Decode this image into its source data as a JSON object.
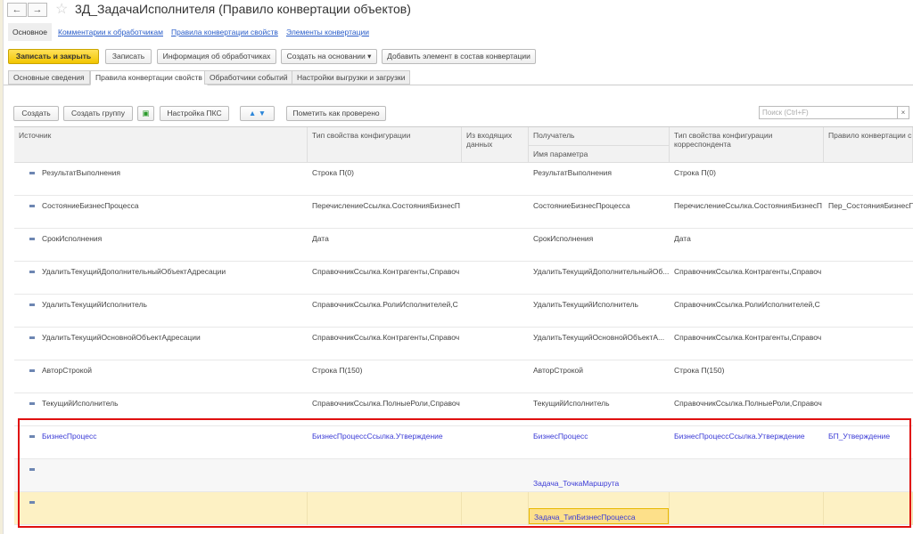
{
  "window": {
    "title": "3Д_ЗадачаИсполнителя (Правило конвертации объектов)",
    "back": "←",
    "forward": "→",
    "star": "☆"
  },
  "sections": [
    "Основное",
    "Комментарии к обработчикам",
    "Правила конвертации свойств",
    "Элементы конвертации"
  ],
  "toolbar": {
    "save_close": "Записать и закрыть",
    "save": "Записать",
    "handlers_info": "Информация об обработчиках",
    "create_based": "Создать на основании",
    "add_element": "Добавить элемент в состав конвертации"
  },
  "tabs": [
    "Основные сведения",
    "Правила конвертации свойств",
    "Обработчики событий",
    "Настройки выгрузки и загрузки"
  ],
  "list_toolbar": {
    "create": "Создать",
    "create_group": "Создать группу",
    "pks": "Настройка ПКС",
    "mark_checked": "Пометить как проверено",
    "search_placeholder": "Поиск (Ctrl+F)",
    "clear": "×"
  },
  "columns": {
    "source": "Источник",
    "type": "Тип свойства конфигурации",
    "incoming": "Из входящих данных",
    "receiver": "Получатель",
    "param": "Имя параметра",
    "corr_type": "Тип свойства конфигурации корреспондента",
    "rule": "Правило конвертации св"
  },
  "rows": [
    {
      "source": "РезультатВыполнения",
      "type": "Строка П(0)",
      "receiver": "РезультатВыполнения",
      "corr_type": "Строка П(0)",
      "rule": ""
    },
    {
      "source": "СостояниеБизнесПроцесса",
      "type": "ПеречислениеСсылка.СостоянияБизнесП",
      "receiver": "СостояниеБизнесПроцесса",
      "corr_type": "ПеречислениеСсылка.СостоянияБизнесП",
      "rule": "Пер_СостоянияБизнесПр"
    },
    {
      "source": "СрокИсполнения",
      "type": "Дата",
      "receiver": "СрокИсполнения",
      "corr_type": "Дата",
      "rule": ""
    },
    {
      "source": "УдалитьТекущийДополнительныйОбъектАдресации",
      "type": "СправочникСсылка.Контрагенты,Справоч",
      "receiver": "УдалитьТекущийДополнительныйОб...",
      "corr_type": "СправочникСсылка.Контрагенты,Справоч",
      "rule": ""
    },
    {
      "source": "УдалитьТекущийИсполнитель",
      "type": "СправочникСсылка.РолиИсполнителей,С",
      "receiver": "УдалитьТекущийИсполнитель",
      "corr_type": "СправочникСсылка.РолиИсполнителей,С",
      "rule": ""
    },
    {
      "source": "УдалитьТекущийОсновнойОбъектАдресации",
      "type": "СправочникСсылка.Контрагенты,Справоч",
      "receiver": "УдалитьТекущийОсновнойОбъектА...",
      "corr_type": "СправочникСсылка.Контрагенты,Справоч",
      "rule": ""
    },
    {
      "source": "АвторСтрокой",
      "type": "Строка П(150)",
      "receiver": "АвторСтрокой",
      "corr_type": "Строка П(150)",
      "rule": ""
    },
    {
      "source": "ТекущийИсполнитель",
      "type": "СправочникСсылка.ПолныеРоли,Справоч",
      "receiver": "ТекущийИсполнитель",
      "corr_type": "СправочникСсылка.ПолныеРоли,Справоч",
      "rule": ""
    },
    {
      "source": "БизнесПроцесс",
      "type": "БизнесПроцессСсылка.Утверждение",
      "receiver": "БизнесПроцесс",
      "corr_type": "БизнесПроцессСсылка.Утверждение",
      "rule": "БП_Утверждение"
    },
    {
      "source": "",
      "type": "",
      "receiver": "",
      "param": "Задача_ТочкаМаршрута",
      "corr_type": "",
      "rule": ""
    },
    {
      "source": "",
      "type": "",
      "receiver": "",
      "param": "Задача_ТипБизнесПроцесса",
      "corr_type": "",
      "rule": ""
    }
  ]
}
